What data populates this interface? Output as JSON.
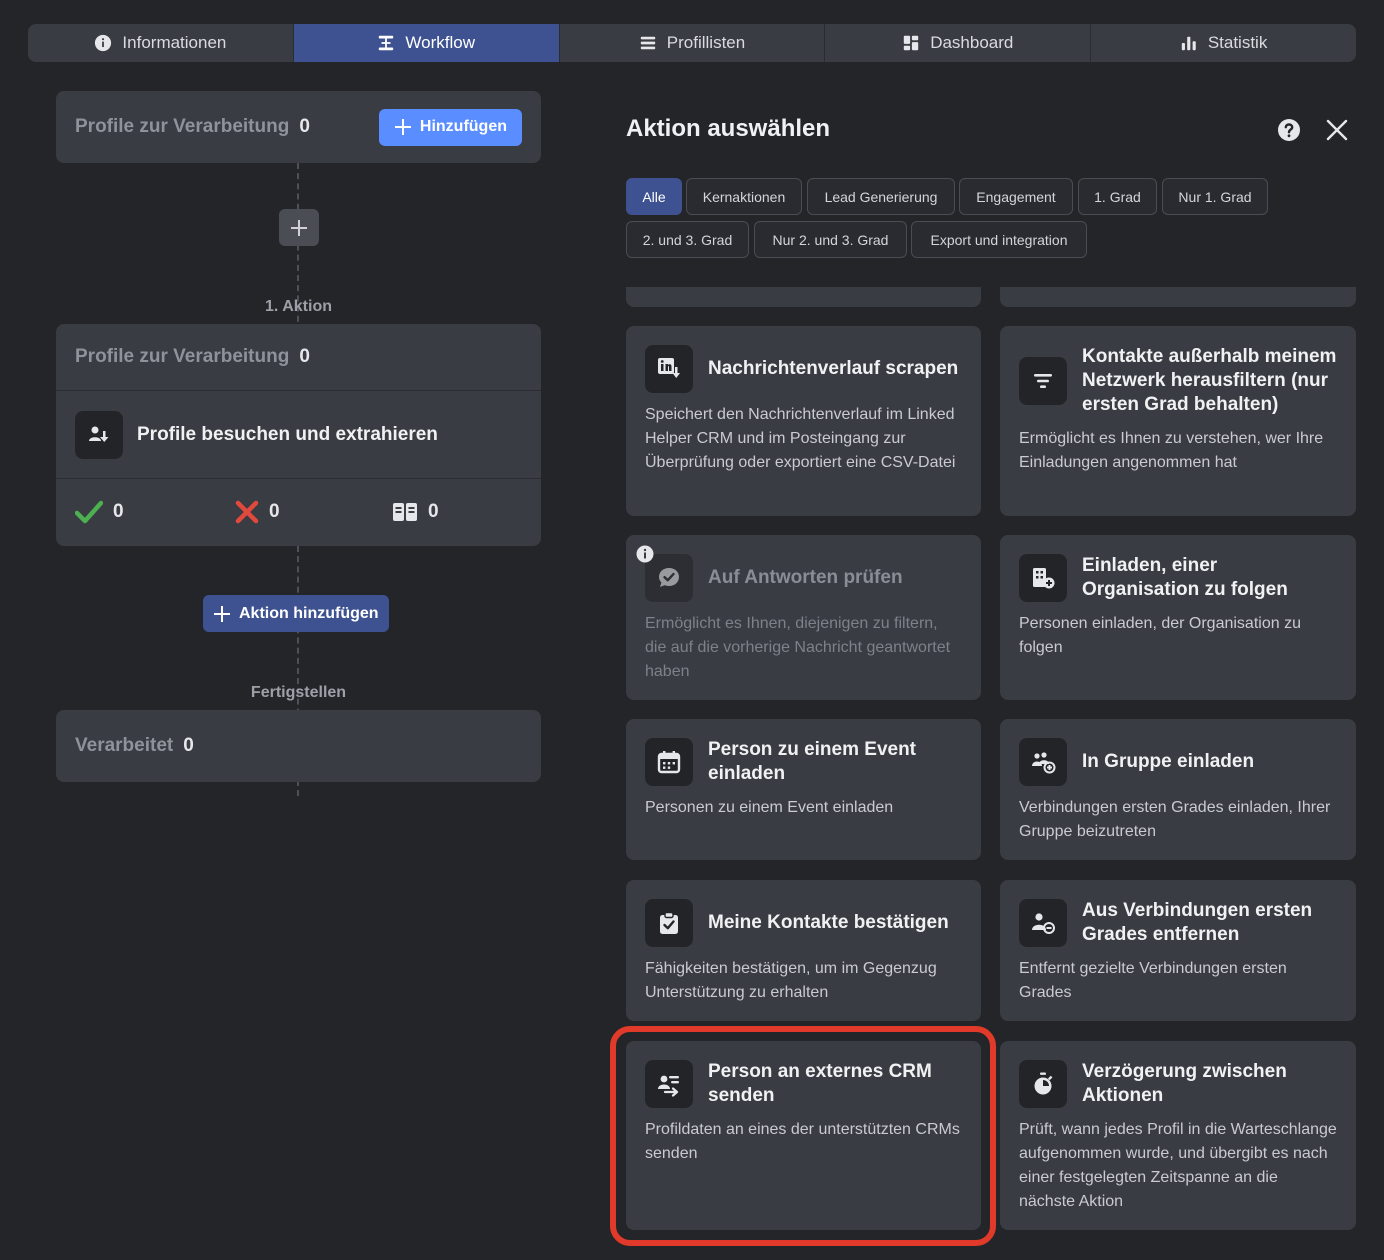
{
  "tabs": [
    {
      "label": "Informationen",
      "icon": "info-icon"
    },
    {
      "label": "Workflow",
      "icon": "workflow-icon",
      "active": true
    },
    {
      "label": "Profillisten",
      "icon": "list-icon"
    },
    {
      "label": "Dashboard",
      "icon": "dashboard-icon"
    },
    {
      "label": "Statistik",
      "icon": "bar-chart-icon"
    }
  ],
  "workflow": {
    "start": {
      "label": "Profile zur Verarbeitung",
      "count": "0",
      "add_button": "Hinzufügen"
    },
    "step1_label": "1. Aktion",
    "step1": {
      "label": "Profile zur Verarbeitung",
      "count": "0",
      "action_title": "Profile besuchen und extrahieren",
      "success": "0",
      "failed": "0",
      "skipped": "0"
    },
    "add_action_button": "Aktion hinzufügen",
    "finish_label": "Fertigstellen",
    "finish": {
      "label": "Verarbeitet",
      "count": "0"
    }
  },
  "modal": {
    "title": "Aktion auswählen",
    "filters": [
      "Alle",
      "Kernaktionen",
      "Lead Generierung",
      "Engagement",
      "1. Grad",
      "Nur 1. Grad",
      "2. und 3. Grad",
      "Nur 2. und 3. Grad",
      "Export und integration"
    ],
    "active_filter": "Alle",
    "cards": [
      {
        "title": "Nachrichtenverlauf scrapen",
        "desc": "Speichert den Nachrichtenverlauf im Linked Helper CRM und im Posteingang zur Überprüfung oder exportiert eine CSV-Datei",
        "icon": "linkedin-download-icon"
      },
      {
        "title": "Kontakte außerhalb meinem Netzwerk herausfiltern (nur ersten Grad behalten)",
        "desc": "Ermöglicht es Ihnen zu verstehen, wer Ihre Einladungen angenommen hat",
        "icon": "filter-icon"
      },
      {
        "title": "Auf Antworten prüfen",
        "desc": "Ermöglicht es Ihnen, diejenigen zu filtern, die auf die vorherige Nachricht geantwortet haben",
        "icon": "chat-check-icon",
        "disabled": true
      },
      {
        "title": "Einladen, einer Organisation zu folgen",
        "desc": "Personen einladen, der Organisation zu folgen",
        "icon": "building-plus-icon"
      },
      {
        "title": "Person zu einem Event einladen",
        "desc": "Personen zu einem Event einladen",
        "icon": "calendar-icon"
      },
      {
        "title": "In Gruppe einladen",
        "desc": "Verbindungen ersten Grades einladen, Ihrer Gruppe beizutreten",
        "icon": "group-plus-icon"
      },
      {
        "title": "Meine Kontakte bestätigen",
        "desc": "Fähigkeiten bestätigen, um im Gegenzug Unterstützung zu erhalten",
        "icon": "clipboard-check-icon"
      },
      {
        "title": "Aus Verbindungen ersten Grades entfernen",
        "desc": "Entfernt gezielte Verbindungen ersten Grades",
        "icon": "user-minus-icon"
      },
      {
        "title": "Person an externes CRM senden",
        "desc": "Profildaten an eines der unterstützten CRMs senden",
        "icon": "crm-send-icon"
      },
      {
        "title": "Verzögerung zwischen Aktionen",
        "desc": "Prüft, wann jedes Profil in die Warteschlange aufgenommen wurde, und übergibt es nach einer festgelegten Zeitspanne an die nächste Aktion",
        "icon": "timer-icon"
      }
    ]
  },
  "colors": {
    "accent": "#5a8dff",
    "active_tab": "#3e5291",
    "highlight": "#e23a2a",
    "success": "#4caf50",
    "failed": "#e0493b"
  }
}
